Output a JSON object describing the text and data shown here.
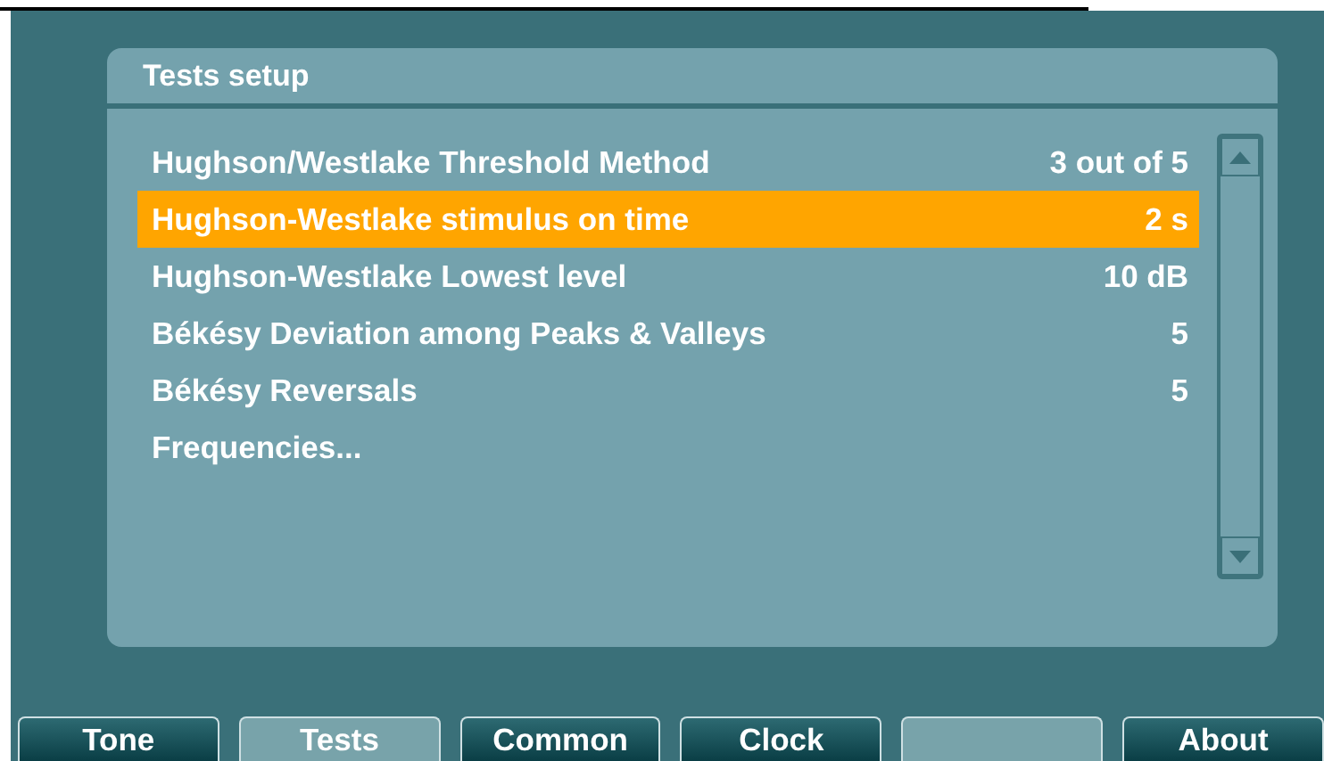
{
  "panel": {
    "title": "Tests setup"
  },
  "settings": [
    {
      "label": "Hughson/Westlake Threshold Method",
      "value": "3 out of 5",
      "selected": false
    },
    {
      "label": "Hughson-Westlake stimulus on time",
      "value": "2 s",
      "selected": true
    },
    {
      "label": "Hughson-Westlake Lowest level",
      "value": "10 dB",
      "selected": false
    },
    {
      "label": "Békésy Deviation among Peaks & Valleys",
      "value": "5",
      "selected": false
    },
    {
      "label": "Békésy Reversals",
      "value": "5",
      "selected": false
    },
    {
      "label": "Frequencies...",
      "selected": false
    }
  ],
  "tabs": [
    {
      "kind": "label",
      "label": "Tone",
      "selected": false
    },
    {
      "kind": "label",
      "label": "Tests",
      "selected": true
    },
    {
      "kind": "label",
      "label": "Common",
      "selected": false
    },
    {
      "kind": "label",
      "label": "Clock",
      "selected": false
    },
    {
      "kind": "blank"
    },
    {
      "kind": "label",
      "label": "About",
      "selected": false
    }
  ]
}
